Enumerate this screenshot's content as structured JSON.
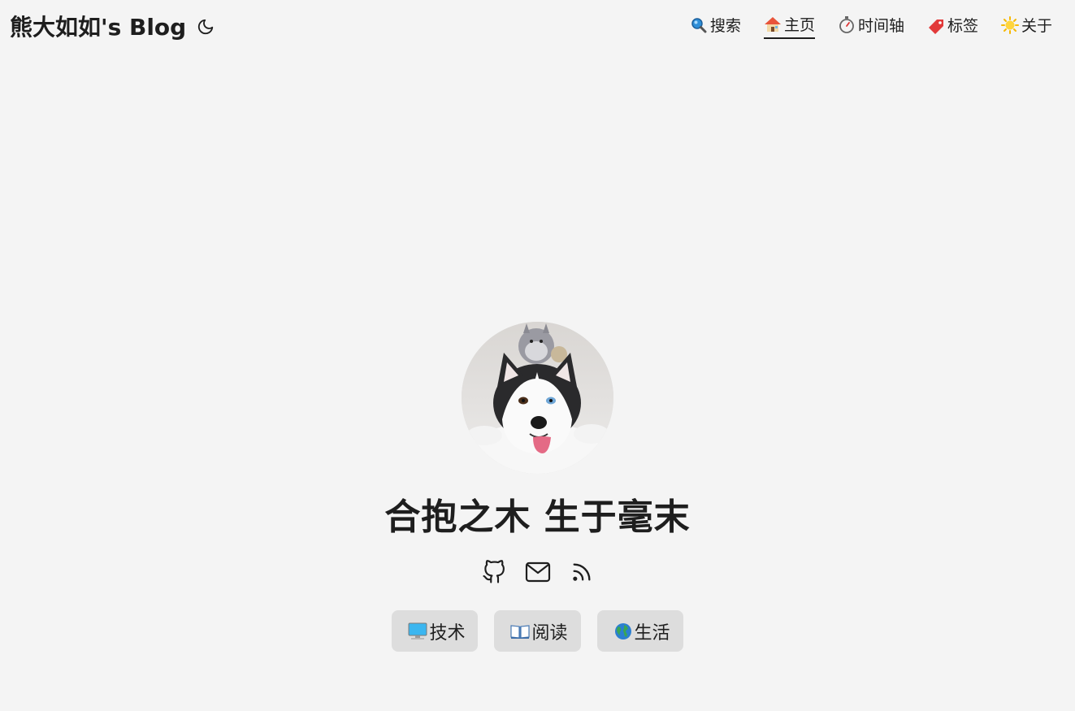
{
  "header": {
    "site_title": "熊大如如's Blog",
    "theme_toggle_icon": "moon-icon"
  },
  "nav": {
    "items": [
      {
        "label": "搜索",
        "icon": "magnifier-icon"
      },
      {
        "label": "主页",
        "icon": "house-icon",
        "active": true
      },
      {
        "label": "时间轴",
        "icon": "stopwatch-icon"
      },
      {
        "label": "标签",
        "icon": "tag-icon"
      },
      {
        "label": "关于",
        "icon": "sun-icon"
      }
    ]
  },
  "profile": {
    "slogan": "合抱之木 生于毫末",
    "socials": [
      {
        "icon": "github-icon"
      },
      {
        "icon": "mail-icon"
      },
      {
        "icon": "rss-icon"
      }
    ]
  },
  "categories": [
    {
      "label": "技术",
      "icon": "computer-icon"
    },
    {
      "label": "阅读",
      "icon": "book-icon"
    },
    {
      "label": "生活",
      "icon": "globe-icon"
    }
  ],
  "colors": {
    "background": "#f4f4f4",
    "text": "#1e1e1e",
    "button_bg": "#dddddd"
  }
}
